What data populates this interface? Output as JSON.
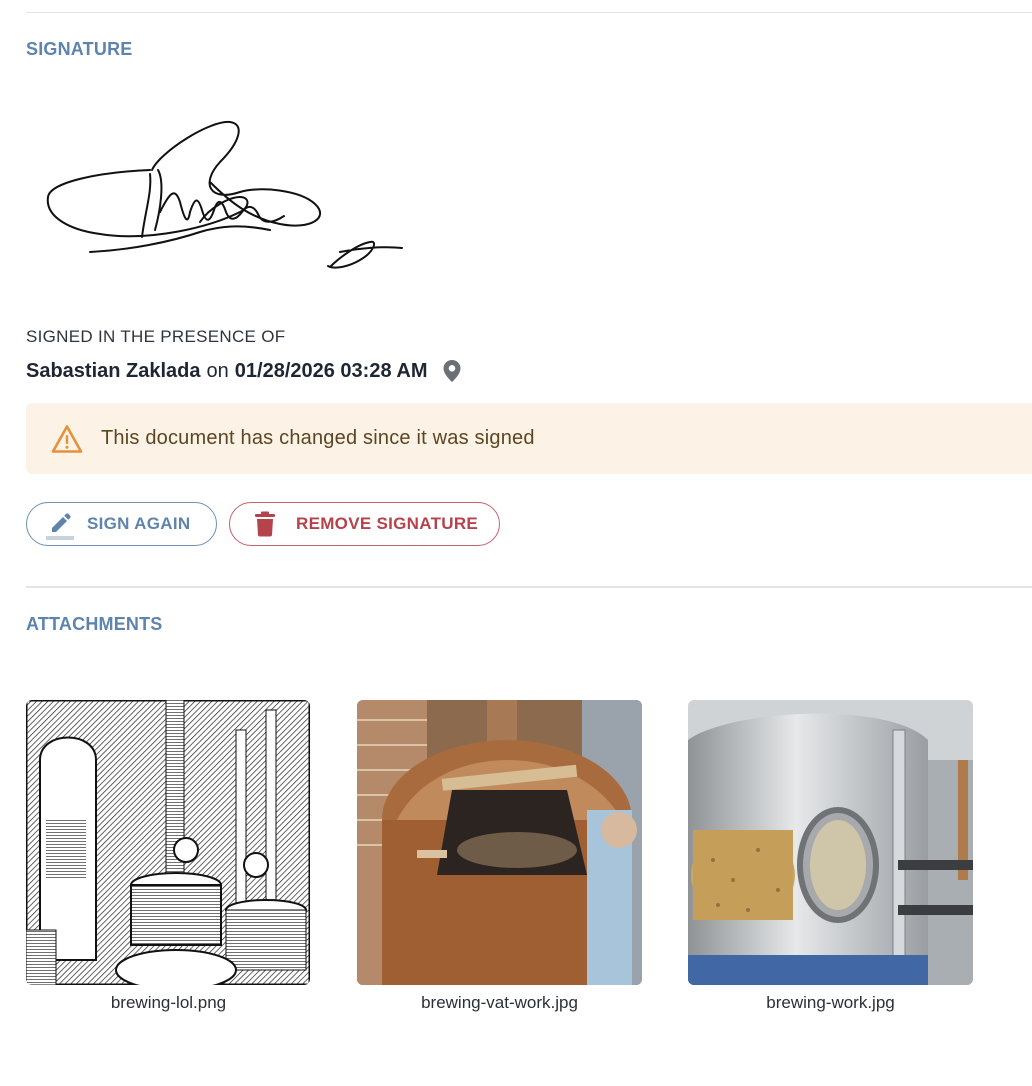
{
  "signature_section": {
    "title": "SIGNATURE",
    "presence_label": "SIGNED IN THE PRESENCE OF",
    "signer_name": "Sabastian Zaklada",
    "on_word": "on",
    "signed_at": "01/28/2026 03:28 AM",
    "location_icon": "map-pin-icon"
  },
  "warning": {
    "icon": "warning-triangle-icon",
    "message": "This document has changed since it was signed",
    "color": "#fcf2e6"
  },
  "actions": {
    "sign_again": {
      "label": "SIGN AGAIN",
      "icon": "pen-icon",
      "color": "#5e84ad"
    },
    "remove_signature": {
      "label": "REMOVE SIGNATURE",
      "icon": "trash-icon",
      "color": "#b5434c"
    }
  },
  "attachments": {
    "title": "ATTACHMENTS",
    "items": [
      {
        "filename": "brewing-lol.png"
      },
      {
        "filename": "brewing-vat-work.jpg"
      },
      {
        "filename": "brewing-work.jpg"
      }
    ]
  }
}
